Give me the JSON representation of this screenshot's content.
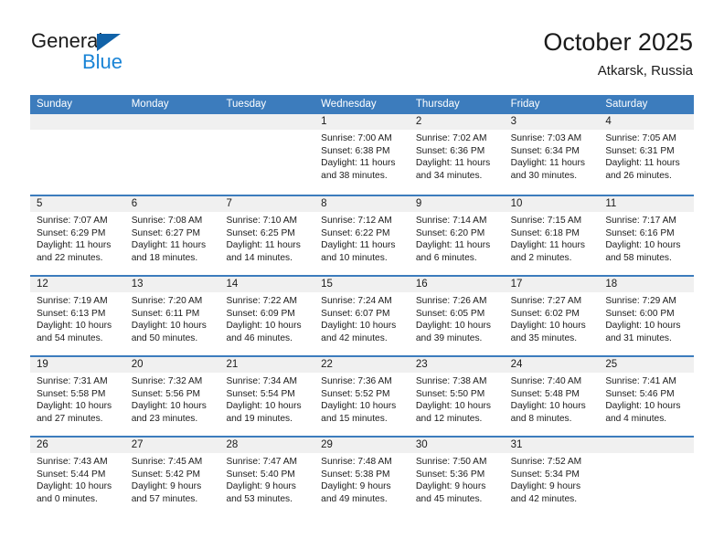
{
  "brand": {
    "name_part1": "General",
    "name_part2": "Blue",
    "triangle_icon": "triangle-icon",
    "color_dark": "#1b1b1b",
    "color_blue": "#1a84d6"
  },
  "header": {
    "title": "October 2025",
    "subtitle": "Atkarsk, Russia"
  },
  "theme": {
    "header_bar": "#3c7cbd",
    "date_band": "#f0f0f0",
    "text": "#1b1b1b"
  },
  "calendar": {
    "weekdays": [
      "Sunday",
      "Monday",
      "Tuesday",
      "Wednesday",
      "Thursday",
      "Friday",
      "Saturday"
    ],
    "weeks": [
      [
        {
          "date": "",
          "sunrise": "",
          "sunset": "",
          "daylight_line1": "",
          "daylight_line2": ""
        },
        {
          "date": "",
          "sunrise": "",
          "sunset": "",
          "daylight_line1": "",
          "daylight_line2": ""
        },
        {
          "date": "",
          "sunrise": "",
          "sunset": "",
          "daylight_line1": "",
          "daylight_line2": ""
        },
        {
          "date": "1",
          "sunrise": "Sunrise: 7:00 AM",
          "sunset": "Sunset: 6:38 PM",
          "daylight_line1": "Daylight: 11 hours",
          "daylight_line2": "and 38 minutes."
        },
        {
          "date": "2",
          "sunrise": "Sunrise: 7:02 AM",
          "sunset": "Sunset: 6:36 PM",
          "daylight_line1": "Daylight: 11 hours",
          "daylight_line2": "and 34 minutes."
        },
        {
          "date": "3",
          "sunrise": "Sunrise: 7:03 AM",
          "sunset": "Sunset: 6:34 PM",
          "daylight_line1": "Daylight: 11 hours",
          "daylight_line2": "and 30 minutes."
        },
        {
          "date": "4",
          "sunrise": "Sunrise: 7:05 AM",
          "sunset": "Sunset: 6:31 PM",
          "daylight_line1": "Daylight: 11 hours",
          "daylight_line2": "and 26 minutes."
        }
      ],
      [
        {
          "date": "5",
          "sunrise": "Sunrise: 7:07 AM",
          "sunset": "Sunset: 6:29 PM",
          "daylight_line1": "Daylight: 11 hours",
          "daylight_line2": "and 22 minutes."
        },
        {
          "date": "6",
          "sunrise": "Sunrise: 7:08 AM",
          "sunset": "Sunset: 6:27 PM",
          "daylight_line1": "Daylight: 11 hours",
          "daylight_line2": "and 18 minutes."
        },
        {
          "date": "7",
          "sunrise": "Sunrise: 7:10 AM",
          "sunset": "Sunset: 6:25 PM",
          "daylight_line1": "Daylight: 11 hours",
          "daylight_line2": "and 14 minutes."
        },
        {
          "date": "8",
          "sunrise": "Sunrise: 7:12 AM",
          "sunset": "Sunset: 6:22 PM",
          "daylight_line1": "Daylight: 11 hours",
          "daylight_line2": "and 10 minutes."
        },
        {
          "date": "9",
          "sunrise": "Sunrise: 7:14 AM",
          "sunset": "Sunset: 6:20 PM",
          "daylight_line1": "Daylight: 11 hours",
          "daylight_line2": "and 6 minutes."
        },
        {
          "date": "10",
          "sunrise": "Sunrise: 7:15 AM",
          "sunset": "Sunset: 6:18 PM",
          "daylight_line1": "Daylight: 11 hours",
          "daylight_line2": "and 2 minutes."
        },
        {
          "date": "11",
          "sunrise": "Sunrise: 7:17 AM",
          "sunset": "Sunset: 6:16 PM",
          "daylight_line1": "Daylight: 10 hours",
          "daylight_line2": "and 58 minutes."
        }
      ],
      [
        {
          "date": "12",
          "sunrise": "Sunrise: 7:19 AM",
          "sunset": "Sunset: 6:13 PM",
          "daylight_line1": "Daylight: 10 hours",
          "daylight_line2": "and 54 minutes."
        },
        {
          "date": "13",
          "sunrise": "Sunrise: 7:20 AM",
          "sunset": "Sunset: 6:11 PM",
          "daylight_line1": "Daylight: 10 hours",
          "daylight_line2": "and 50 minutes."
        },
        {
          "date": "14",
          "sunrise": "Sunrise: 7:22 AM",
          "sunset": "Sunset: 6:09 PM",
          "daylight_line1": "Daylight: 10 hours",
          "daylight_line2": "and 46 minutes."
        },
        {
          "date": "15",
          "sunrise": "Sunrise: 7:24 AM",
          "sunset": "Sunset: 6:07 PM",
          "daylight_line1": "Daylight: 10 hours",
          "daylight_line2": "and 42 minutes."
        },
        {
          "date": "16",
          "sunrise": "Sunrise: 7:26 AM",
          "sunset": "Sunset: 6:05 PM",
          "daylight_line1": "Daylight: 10 hours",
          "daylight_line2": "and 39 minutes."
        },
        {
          "date": "17",
          "sunrise": "Sunrise: 7:27 AM",
          "sunset": "Sunset: 6:02 PM",
          "daylight_line1": "Daylight: 10 hours",
          "daylight_line2": "and 35 minutes."
        },
        {
          "date": "18",
          "sunrise": "Sunrise: 7:29 AM",
          "sunset": "Sunset: 6:00 PM",
          "daylight_line1": "Daylight: 10 hours",
          "daylight_line2": "and 31 minutes."
        }
      ],
      [
        {
          "date": "19",
          "sunrise": "Sunrise: 7:31 AM",
          "sunset": "Sunset: 5:58 PM",
          "daylight_line1": "Daylight: 10 hours",
          "daylight_line2": "and 27 minutes."
        },
        {
          "date": "20",
          "sunrise": "Sunrise: 7:32 AM",
          "sunset": "Sunset: 5:56 PM",
          "daylight_line1": "Daylight: 10 hours",
          "daylight_line2": "and 23 minutes."
        },
        {
          "date": "21",
          "sunrise": "Sunrise: 7:34 AM",
          "sunset": "Sunset: 5:54 PM",
          "daylight_line1": "Daylight: 10 hours",
          "daylight_line2": "and 19 minutes."
        },
        {
          "date": "22",
          "sunrise": "Sunrise: 7:36 AM",
          "sunset": "Sunset: 5:52 PM",
          "daylight_line1": "Daylight: 10 hours",
          "daylight_line2": "and 15 minutes."
        },
        {
          "date": "23",
          "sunrise": "Sunrise: 7:38 AM",
          "sunset": "Sunset: 5:50 PM",
          "daylight_line1": "Daylight: 10 hours",
          "daylight_line2": "and 12 minutes."
        },
        {
          "date": "24",
          "sunrise": "Sunrise: 7:40 AM",
          "sunset": "Sunset: 5:48 PM",
          "daylight_line1": "Daylight: 10 hours",
          "daylight_line2": "and 8 minutes."
        },
        {
          "date": "25",
          "sunrise": "Sunrise: 7:41 AM",
          "sunset": "Sunset: 5:46 PM",
          "daylight_line1": "Daylight: 10 hours",
          "daylight_line2": "and 4 minutes."
        }
      ],
      [
        {
          "date": "26",
          "sunrise": "Sunrise: 7:43 AM",
          "sunset": "Sunset: 5:44 PM",
          "daylight_line1": "Daylight: 10 hours",
          "daylight_line2": "and 0 minutes."
        },
        {
          "date": "27",
          "sunrise": "Sunrise: 7:45 AM",
          "sunset": "Sunset: 5:42 PM",
          "daylight_line1": "Daylight: 9 hours",
          "daylight_line2": "and 57 minutes."
        },
        {
          "date": "28",
          "sunrise": "Sunrise: 7:47 AM",
          "sunset": "Sunset: 5:40 PM",
          "daylight_line1": "Daylight: 9 hours",
          "daylight_line2": "and 53 minutes."
        },
        {
          "date": "29",
          "sunrise": "Sunrise: 7:48 AM",
          "sunset": "Sunset: 5:38 PM",
          "daylight_line1": "Daylight: 9 hours",
          "daylight_line2": "and 49 minutes."
        },
        {
          "date": "30",
          "sunrise": "Sunrise: 7:50 AM",
          "sunset": "Sunset: 5:36 PM",
          "daylight_line1": "Daylight: 9 hours",
          "daylight_line2": "and 45 minutes."
        },
        {
          "date": "31",
          "sunrise": "Sunrise: 7:52 AM",
          "sunset": "Sunset: 5:34 PM",
          "daylight_line1": "Daylight: 9 hours",
          "daylight_line2": "and 42 minutes."
        },
        {
          "date": "",
          "sunrise": "",
          "sunset": "",
          "daylight_line1": "",
          "daylight_line2": ""
        }
      ]
    ]
  }
}
